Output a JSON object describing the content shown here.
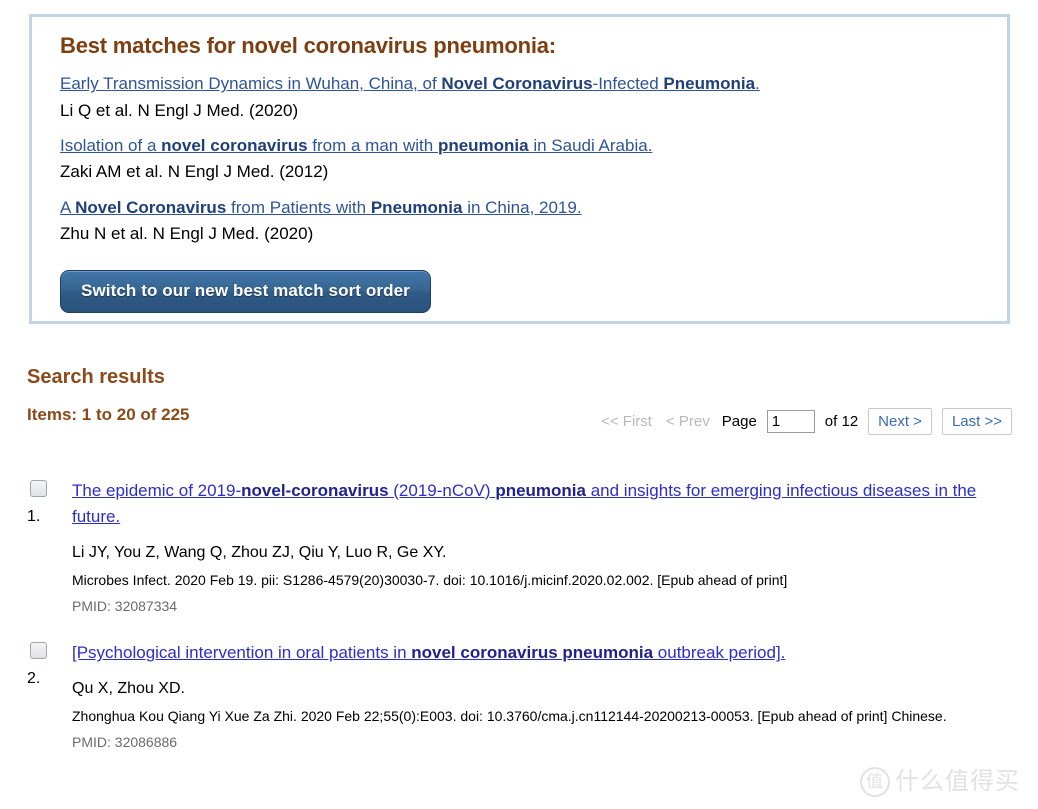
{
  "best_matches": {
    "heading": "Best matches for novel coronavirus pneumonia:",
    "entries": [
      {
        "title_parts": [
          {
            "text": "Early Transmission Dynamics in Wuhan, China, of ",
            "bold": false
          },
          {
            "text": "Novel Coronavirus",
            "bold": true
          },
          {
            "text": "-Infected ",
            "bold": false
          },
          {
            "text": "Pneumonia",
            "bold": true
          },
          {
            "text": ".",
            "bold": false
          }
        ],
        "citation": "Li Q et al. N Engl J Med. (2020)"
      },
      {
        "title_parts": [
          {
            "text": "Isolation of a ",
            "bold": false
          },
          {
            "text": "novel coronavirus",
            "bold": true
          },
          {
            "text": " from a man with ",
            "bold": false
          },
          {
            "text": "pneumonia",
            "bold": true
          },
          {
            "text": " in Saudi Arabia.",
            "bold": false
          }
        ],
        "citation": "Zaki AM et al. N Engl J Med. (2012)"
      },
      {
        "title_parts": [
          {
            "text": "A ",
            "bold": false
          },
          {
            "text": "Novel Coronavirus",
            "bold": true
          },
          {
            "text": " from Patients with ",
            "bold": false
          },
          {
            "text": "Pneumonia",
            "bold": true
          },
          {
            "text": " in China, 2019.",
            "bold": false
          }
        ],
        "citation": "Zhu N et al. N Engl J Med. (2020)"
      }
    ],
    "switch_button_label": "Switch to our new best match sort order"
  },
  "search_results": {
    "heading": "Search results",
    "items_count_label": "Items: 1 to 20 of 225"
  },
  "pager": {
    "first_label": "<< First",
    "prev_label": "< Prev",
    "page_label": "Page",
    "page_value": "1",
    "of_label": "of 12",
    "next_label": "Next >",
    "last_label": "Last >>"
  },
  "results": [
    {
      "index": "1.",
      "title_parts": [
        {
          "text": "The epidemic of 2019-",
          "bold": false
        },
        {
          "text": "novel-coronavirus",
          "bold": true
        },
        {
          "text": " (2019-nCoV) ",
          "bold": false
        },
        {
          "text": "pneumonia",
          "bold": true
        },
        {
          "text": " and insights for emerging infectious diseases in the future.",
          "bold": false
        }
      ],
      "authors": "Li JY, You Z, Wang Q, Zhou ZJ, Qiu Y, Luo R, Ge XY.",
      "source": "Microbes Infect. 2020 Feb 19. pii: S1286-4579(20)30030-7. doi: 10.1016/j.micinf.2020.02.002. [Epub ahead of print]",
      "pmid": "PMID: 32087334"
    },
    {
      "index": "2.",
      "title_parts": [
        {
          "text": "[Psychological intervention in oral patients in ",
          "bold": false
        },
        {
          "text": "novel coronavirus pneumonia",
          "bold": true
        },
        {
          "text": " outbreak period].",
          "bold": false
        }
      ],
      "authors": "Qu X, Zhou XD.",
      "source": "Zhonghua Kou Qiang Yi Xue Za Zhi. 2020 Feb 22;55(0):E003. doi: 10.3760/cma.j.cn112144-20200213-00053. [Epub ahead of print] Chinese.",
      "pmid": "PMID: 32086886"
    }
  ],
  "watermark": {
    "mark": "值",
    "text": "什么值得买"
  },
  "colors": {
    "heading_brown": "#7d3f12",
    "results_brown": "#8b4a1a",
    "panel_border": "#c3d4e4",
    "best_match_link": "#2f5496",
    "result_link": "#2d2dc8",
    "button_blue": "#36648f"
  }
}
